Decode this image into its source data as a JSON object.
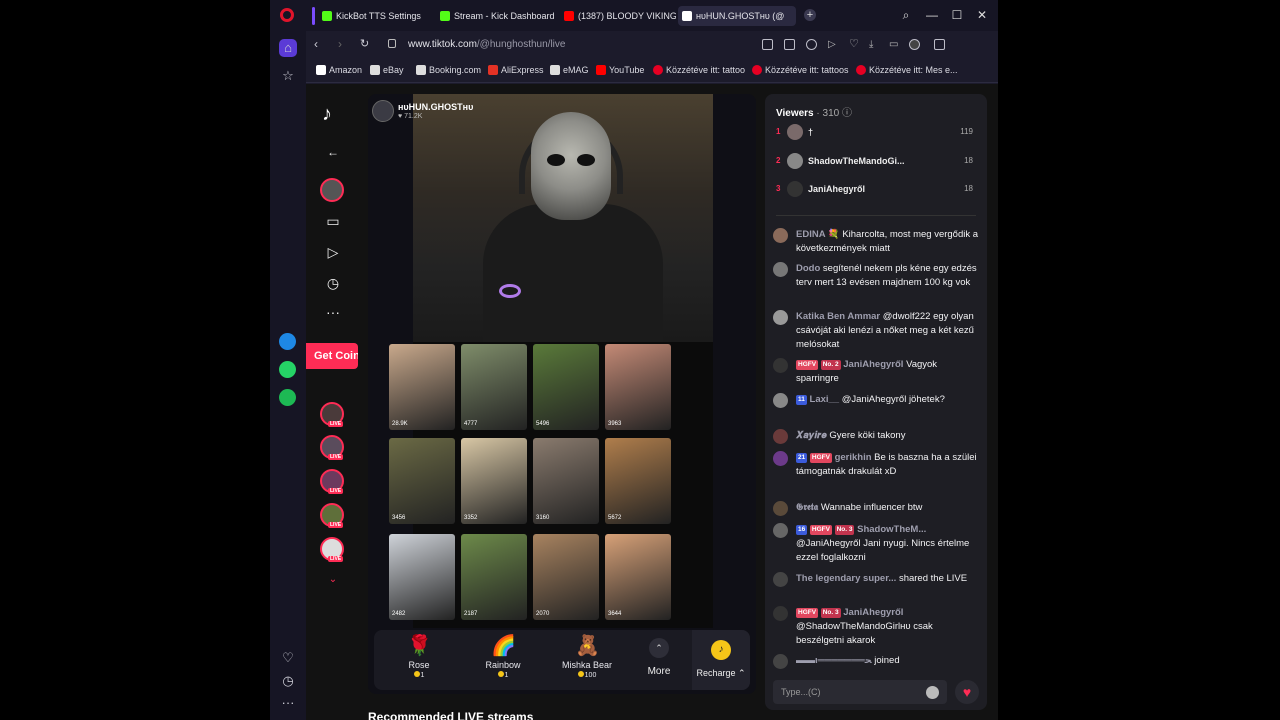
{
  "browser": {
    "tabs": [
      {
        "title": "KickBot TTS Settings",
        "favicon_color": "#53fc18"
      },
      {
        "title": "Stream - Kick Dashboard",
        "favicon_color": "#53fc18"
      },
      {
        "title": "(1387) BLOODY VIKING S",
        "favicon_color": "#ff0000"
      },
      {
        "title": "ʜᴜHUN.GHOSTʜᴜ (@",
        "favicon_color": "#ffffff"
      }
    ],
    "url_host": "www.tiktok.com",
    "url_path": "/@hunghosthun/live",
    "ai_label": "AI",
    "bookmarks": [
      {
        "label": "Amazon",
        "color": "#ffffff"
      },
      {
        "label": "eBay",
        "color": "#dddddd"
      },
      {
        "label": "Booking.com",
        "color": "#dddddd"
      },
      {
        "label": "AliExpress",
        "color": "#e43225"
      },
      {
        "label": "eMAG",
        "color": "#dddddd"
      },
      {
        "label": "YouTube",
        "color": "#ff0000"
      },
      {
        "label": "Közzétéve itt: tattoo",
        "color": "#e60023"
      },
      {
        "label": "Közzétéve itt: tattoos",
        "color": "#e60023"
      },
      {
        "label": "Közzétéve itt: Mes e...",
        "color": "#e60023"
      }
    ]
  },
  "tiktok": {
    "get_coins": "Get Coins",
    "streamer_name": "ʜᴜHUN.GHOSTʜᴜ",
    "streamer_likes": "71.2K",
    "thumbs": [
      {
        "views": "28.9K",
        "color": "#c9a98c"
      },
      {
        "views": "4777",
        "color": "#7f8d6a"
      },
      {
        "views": "5496",
        "color": "#5a7a3a"
      },
      {
        "views": "3963",
        "color": "#c48a76"
      },
      {
        "views": "3456",
        "color": "#6b6a45"
      },
      {
        "views": "3352",
        "color": "#d8c7a5"
      },
      {
        "views": "3160",
        "color": "#8a7b6e"
      },
      {
        "views": "5672",
        "color": "#b07e4c"
      },
      {
        "views": "2482",
        "color": "#cfd3d9"
      },
      {
        "views": "2187",
        "color": "#6d8a4a"
      },
      {
        "views": "2070",
        "color": "#a88360"
      },
      {
        "views": "3644",
        "color": "#d7a178"
      }
    ],
    "gifts": [
      {
        "name": "Rose",
        "price": "1",
        "icon": "🌹"
      },
      {
        "name": "Rainbow",
        "price": "1",
        "icon": "🌈"
      },
      {
        "name": "Mishka Bear",
        "price": "100",
        "icon": "🧸"
      }
    ],
    "more_label": "More",
    "recharge_label": "Recharge",
    "recommended": "Recommended LIVE streams"
  },
  "chat": {
    "viewers_label": "Viewers",
    "viewers_count": "· 310",
    "ranking": [
      {
        "rank": "1",
        "name": "†",
        "score": "119"
      },
      {
        "rank": "2",
        "name": "ShadowTheMandoGi...",
        "score": "18"
      },
      {
        "rank": "3",
        "name": "JaniAhegyről",
        "score": "18"
      }
    ],
    "messages": [
      {
        "user": "EDINA 💐",
        "text": "Kiharcolta, most meg vergődik a következmények miatt",
        "badges": []
      },
      {
        "user": "Dodo",
        "text": "segítenél nekem pls kéne egy edzés terv mert 13 evésen majdnem 100 kg vok",
        "badges": []
      },
      {
        "user": "Katika Ben Ammar",
        "text": "@dwolf222 egy olyan csávóját aki lenézi a nőket meg a két kezű melósokat",
        "badges": []
      },
      {
        "user": "JaniAhegyről",
        "text": "Vagyok sparringre",
        "badges": [
          "HGFV",
          "No. 2"
        ]
      },
      {
        "user": "Laxi__",
        "text": "@JaniAhegyről jöhetek?",
        "badges": [
          "11"
        ]
      },
      {
        "user": "𝑿𝒂𝒚𝒊𝒓𝒆",
        "text": "Gyere köki takony",
        "badges": []
      },
      {
        "user": "gerikhin",
        "text": "Be is baszna ha a szülei támogatnák drakulát xD",
        "badges": [
          "21",
          "HGFV"
        ]
      },
      {
        "user": "𝕲𝖗𝖊𝖙𝖆",
        "text": "Wannabe influencer btw",
        "badges": []
      },
      {
        "user": "ShadowTheM...",
        "text": "@JaniAhegyről Jani nyugi. Nincs értelme ezzel foglalkozni",
        "badges": [
          "16",
          "HGFV",
          "No. 3"
        ]
      },
      {
        "user": "The legendary super...",
        "text": "shared the LIVE",
        "badges": []
      },
      {
        "user": "JaniAhegyről",
        "text": "@ShadowTheMandoGirlʜᴜ csak beszélgetni akarok",
        "badges": [
          "HGFV",
          "No. 3"
        ]
      },
      {
        "user": "▬▬ι═══════ﺤ",
        "text": "joined",
        "badges": []
      }
    ],
    "input_placeholder": "Type...(C)"
  }
}
